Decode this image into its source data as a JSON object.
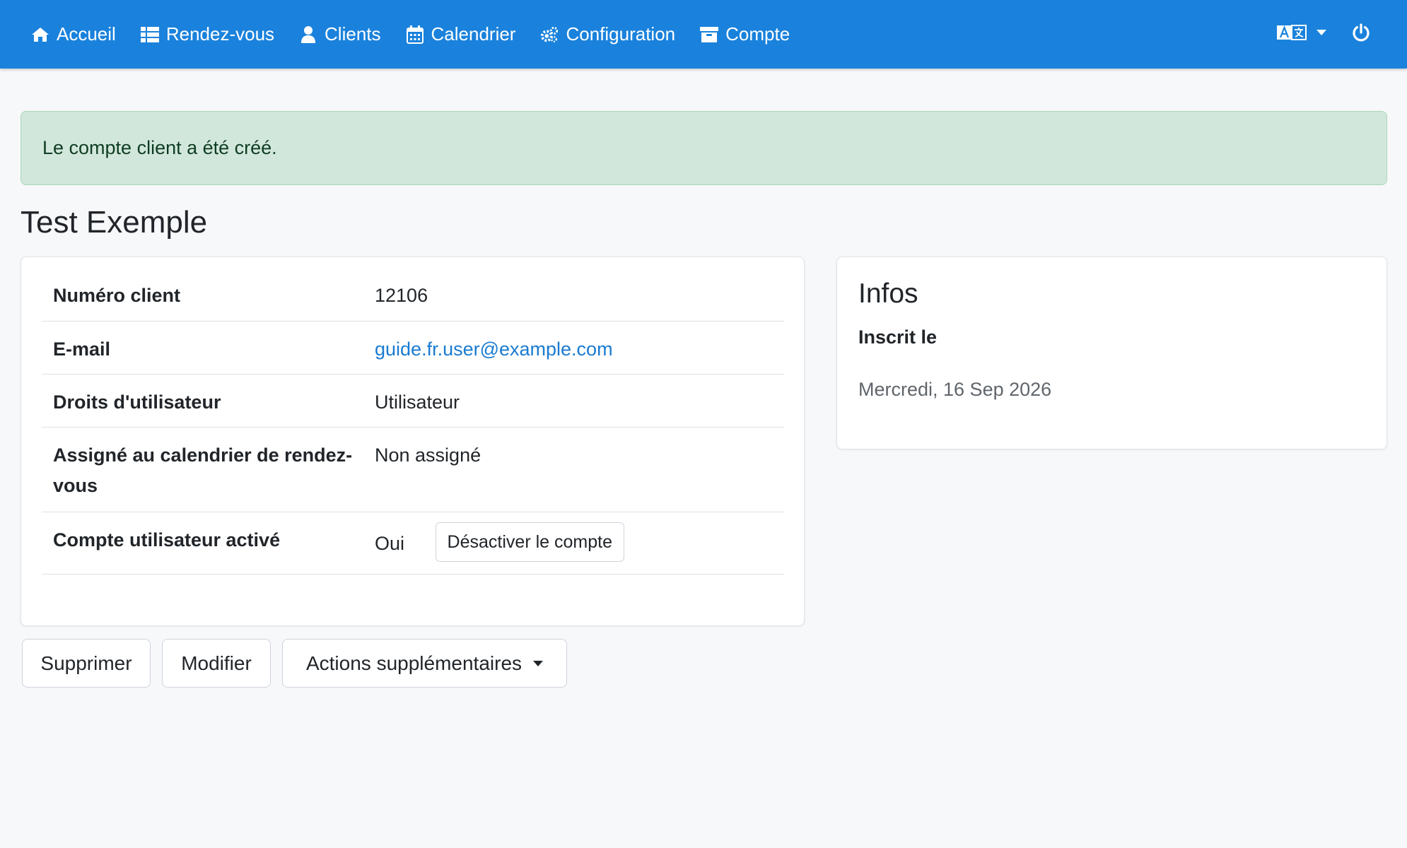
{
  "nav": {
    "items": [
      {
        "label": "Accueil",
        "icon": "home-icon"
      },
      {
        "label": "Rendez-vous",
        "icon": "list-icon"
      },
      {
        "label": "Clients",
        "icon": "user-icon"
      },
      {
        "label": "Calendrier",
        "icon": "calendar-icon"
      },
      {
        "label": "Configuration",
        "icon": "gears-icon"
      },
      {
        "label": "Compte",
        "icon": "archive-icon"
      }
    ],
    "right": {
      "language_icon": "language-icon",
      "logout_icon": "power-icon"
    },
    "color": "#1a82dc"
  },
  "alert": {
    "text": "Le compte client a été créé.",
    "color": "#d2e7dc"
  },
  "page": {
    "title": "Test Exemple"
  },
  "details": {
    "rows": [
      {
        "label": "Numéro client",
        "value": "12106"
      },
      {
        "label": "E-mail",
        "value": "guide.fr.user@example.com"
      },
      {
        "label": "Droits d'utilisateur",
        "value": "Utilisateur"
      },
      {
        "label": "Assigné au calendrier de rendez-vous",
        "value": "Non assigné"
      },
      {
        "label": "Compte utilisateur activé",
        "value": "Oui",
        "action": "Désactiver le compte"
      }
    ]
  },
  "info": {
    "title": "Infos",
    "registered_label": "Inscrit le",
    "registered_value": "Mercredi, 16 Sep 2026"
  },
  "actions": {
    "delete": "Supprimer",
    "edit": "Modifier",
    "more": "Actions supplémentaires"
  }
}
